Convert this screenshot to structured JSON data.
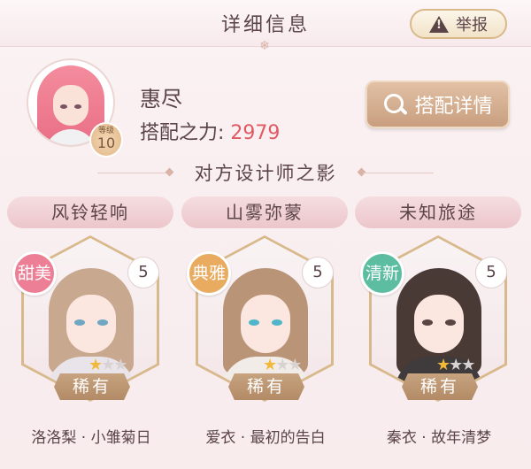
{
  "header": {
    "title": "详细信息",
    "report_label": "举报"
  },
  "profile": {
    "name": "惠尽",
    "level_label": "等级",
    "level": "10",
    "power_label": "搭配之力:",
    "power_value": "2979",
    "match_detail_label": "搭配详情"
  },
  "section": {
    "title": "对方设计师之影"
  },
  "cards": [
    {
      "tag": "风铃轻响",
      "style": "甜美",
      "style_color": "#ec7f95",
      "count": "5",
      "rarity": "稀有",
      "stars_filled": 1,
      "stars_total": 3,
      "name": "洛洛梨 · 小雏菊日",
      "hair_color": "#c8a88e",
      "eye_color": "#6fa6c1",
      "outfit_color": "#e9e4ea"
    },
    {
      "tag": "山雾弥蒙",
      "style": "典雅",
      "style_color": "#e8ab5f",
      "count": "5",
      "rarity": "稀有",
      "stars_filled": 1,
      "stars_total": 3,
      "name": "爱衣 · 最初的告白",
      "hair_color": "#b99477",
      "eye_color": "#4fb6c9",
      "outfit_color": "#f1ece8"
    },
    {
      "tag": "未知旅途",
      "style": "清新",
      "style_color": "#5cbda0",
      "count": "5",
      "rarity": "稀有",
      "stars_filled": 1,
      "stars_total": 3,
      "name": "秦衣 · 故年清梦",
      "hair_color": "#4a3a36",
      "eye_color": "#5a4542",
      "outfit_color": "#3f3a3b"
    }
  ],
  "colors": {
    "accent_red": "#e05a62",
    "button_brown": "#c89d7e",
    "tag_pink": "#ecc6cb"
  }
}
